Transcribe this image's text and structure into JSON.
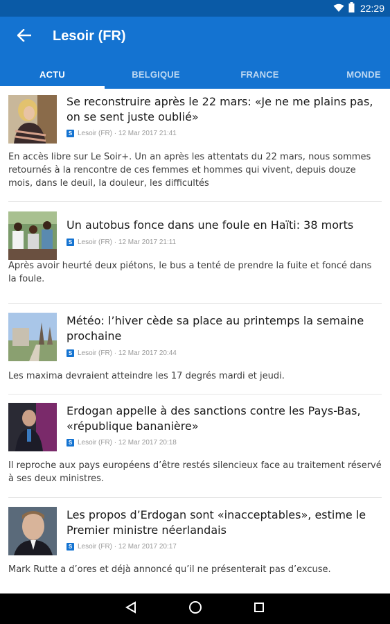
{
  "status": {
    "time": "22:29"
  },
  "app": {
    "title": "Lesoir (FR)"
  },
  "tabs": [
    {
      "label": "ACTU",
      "active": true
    },
    {
      "label": "BELGIQUE",
      "active": false
    },
    {
      "label": "FRANCE",
      "active": false
    },
    {
      "label": "MONDE",
      "active": false
    }
  ],
  "articles": [
    {
      "headline": "Se reconstruire après le 22 mars: «Je ne me plains pas, on se sent juste oublié»",
      "meta": "Lesoir (FR) · 12 Mar 2017 21:41",
      "summary": "En accès libre sur Le Soir+. Un an après les attentats du 22 mars, nous sommes retournés à la rencontre de ces femmes et hommes qui vivent, depuis douze mois, dans le deuil, la douleur, les difficultés"
    },
    {
      "headline": "Un autobus fonce dans une foule en Haïti: 38 morts",
      "meta": "Lesoir (FR) · 12 Mar 2017 21:11",
      "summary": "Après avoir heurté deux piétons, le bus a tenté de prendre la fuite et foncé dans la foule."
    },
    {
      "headline": "Météo: l’hiver cède sa place au printemps la semaine prochaine",
      "meta": "Lesoir (FR) · 12 Mar 2017 20:44",
      "summary": "Les maxima devraient atteindre les 17 degrés mardi et jeudi."
    },
    {
      "headline": "Erdogan appelle à des sanctions contre les Pays-Bas, «république bananière»",
      "meta": "Lesoir (FR) · 12 Mar 2017 20:18",
      "summary": "Il reproche aux pays européens d’être restés silencieux face au traitement réservé à ses deux ministres."
    },
    {
      "headline": "Les propos d’Erdogan sont «inacceptables», estime le Premier ministre néerlandais",
      "meta": "Lesoir (FR) · 12 Mar 2017 20:17",
      "summary": "Mark Rutte a d’ores et déjà annoncé qu’il ne présenterait pas d’excuse."
    }
  ],
  "colors": {
    "primary": "#1473d1",
    "status_bar": "#0a5aa6"
  },
  "icons": {
    "back": "arrow-left-icon",
    "source": "source-logo-icon",
    "nav": [
      "back-triangle-icon",
      "home-circle-icon",
      "recents-square-icon"
    ]
  }
}
